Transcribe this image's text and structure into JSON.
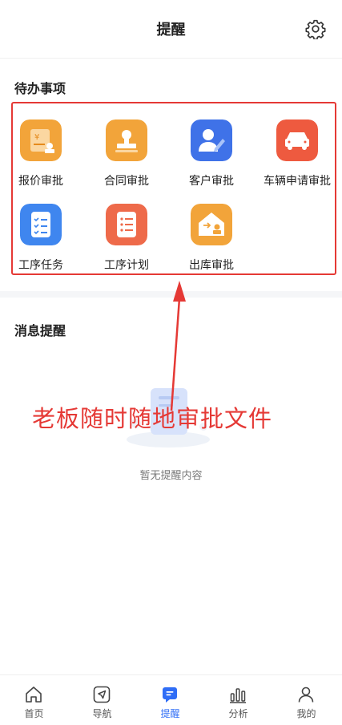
{
  "header": {
    "title": "提醒",
    "settings_icon": "gear-icon"
  },
  "todo": {
    "title": "待办事项",
    "items": [
      {
        "label": "报价审批",
        "icon": "quote-approval-icon",
        "color": "#f2a43a"
      },
      {
        "label": "合同审批",
        "icon": "contract-approval-icon",
        "color": "#f2a43a"
      },
      {
        "label": "客户审批",
        "icon": "customer-approval-icon",
        "color": "#3f72e8"
      },
      {
        "label": "车辆申请审批",
        "icon": "vehicle-application-icon",
        "color": "#ee5a3f"
      },
      {
        "label": "工序任务",
        "icon": "process-task-icon",
        "color": "#3f86ef"
      },
      {
        "label": "工序计划",
        "icon": "process-plan-icon",
        "color": "#ee6a4a"
      },
      {
        "label": "出库审批",
        "icon": "outbound-approval-icon",
        "color": "#f2a43a"
      }
    ]
  },
  "messages": {
    "title": "消息提醒",
    "empty_text": "暂无提醒内容"
  },
  "annotation": {
    "text": "老板随时随地审批文件",
    "color": "#e53935"
  },
  "tabbar": {
    "active_color": "#2f6df6",
    "items": [
      {
        "label": "首页",
        "icon": "home-icon"
      },
      {
        "label": "导航",
        "icon": "navigation-icon"
      },
      {
        "label": "提醒",
        "icon": "reminder-icon",
        "active": true
      },
      {
        "label": "分析",
        "icon": "analytics-icon"
      },
      {
        "label": "我的",
        "icon": "profile-icon"
      }
    ]
  }
}
